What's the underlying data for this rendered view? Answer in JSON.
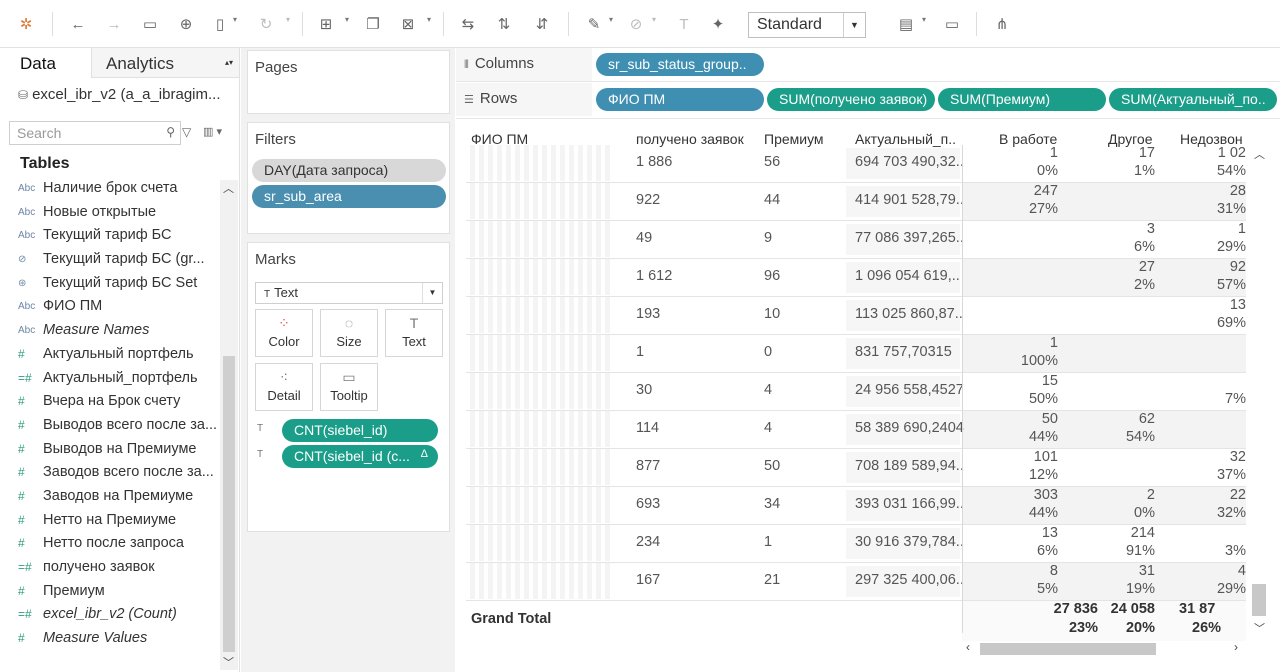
{
  "toolbar": {
    "view_mode": "Standard"
  },
  "data_pane": {
    "tab_data": "Data",
    "tab_analytics": "Analytics",
    "datasource": "excel_ibr_v2 (a_a_ibragim...",
    "search_placeholder": "Search",
    "tables_label": "Tables",
    "fields": [
      {
        "type": "Abc",
        "name": "Наличие брок счета",
        "kind": "dim"
      },
      {
        "type": "Abc",
        "name": "Новые открытые",
        "kind": "dim"
      },
      {
        "type": "Abc",
        "name": "Текущий тариф БС",
        "kind": "dim"
      },
      {
        "type": "⊘",
        "name": "Текущий тариф БС (gr...",
        "kind": "dim"
      },
      {
        "type": "⊛",
        "name": "Текущий тариф БС Set",
        "kind": "dim"
      },
      {
        "type": "Abc",
        "name": "ФИО ПМ",
        "kind": "dim"
      },
      {
        "type": "Abc",
        "name": "Measure Names",
        "kind": "dim",
        "italic": true
      },
      {
        "type": "#",
        "name": "Актуальный портфель",
        "kind": "measure"
      },
      {
        "type": "=#",
        "name": "Актуальный_портфель",
        "kind": "measure"
      },
      {
        "type": "#",
        "name": "Вчера на Брок счету",
        "kind": "measure"
      },
      {
        "type": "#",
        "name": "Выводов всего после за...",
        "kind": "measure"
      },
      {
        "type": "#",
        "name": "Выводов на Премиуме",
        "kind": "measure"
      },
      {
        "type": "#",
        "name": "Заводов всего после за...",
        "kind": "measure"
      },
      {
        "type": "#",
        "name": "Заводов на Премиуме",
        "kind": "measure"
      },
      {
        "type": "#",
        "name": "Нетто на Премиуме",
        "kind": "measure"
      },
      {
        "type": "#",
        "name": "Нетто после запроса",
        "kind": "measure"
      },
      {
        "type": "=#",
        "name": "получено заявок",
        "kind": "measure"
      },
      {
        "type": "#",
        "name": "Премиум",
        "kind": "measure"
      },
      {
        "type": "=#",
        "name": "excel_ibr_v2 (Count)",
        "kind": "measure",
        "italic": true
      },
      {
        "type": "#",
        "name": "Measure Values",
        "kind": "measure",
        "italic": true
      }
    ]
  },
  "cards": {
    "pages_title": "Pages",
    "filters_title": "Filters",
    "filters": [
      "DAY(Дата запроса)",
      "sr_sub_area"
    ],
    "marks_title": "Marks",
    "marks_type": "Text",
    "mark_buttons": [
      "Color",
      "Size",
      "Text",
      "Detail",
      "Tooltip"
    ],
    "mark_pills": [
      "CNT(siebel_id)",
      "CNT(siebel_id (c..."
    ]
  },
  "shelves": {
    "columns_label": "Columns",
    "rows_label": "Rows",
    "columns": [
      "sr_sub_status_group.."
    ],
    "rows": [
      "ФИО ПМ",
      "SUM(получено заявок)",
      "SUM(Премиум)",
      "SUM(Актуальный_по.."
    ]
  },
  "table": {
    "headers": [
      "ФИО ПМ",
      "получено заявок",
      "Премиум",
      "Актуальный_п..",
      "В работе",
      "Другое",
      "Недозвон"
    ],
    "rows": [
      {
        "received": "1 886",
        "premium": "56",
        "portfolio": "694 703 490,32..",
        "work": [
          "1",
          "0%"
        ],
        "other": [
          "17",
          "1%"
        ],
        "nocall": [
          "1 02",
          "54%"
        ]
      },
      {
        "received": "922",
        "premium": "44",
        "portfolio": "414 901 528,79..",
        "work": [
          "247",
          "27%"
        ],
        "other": [
          "",
          ""
        ],
        "nocall": [
          "28",
          "31%"
        ]
      },
      {
        "received": "49",
        "premium": "9",
        "portfolio": "77 086 397,265..",
        "work": [
          "",
          ""
        ],
        "other": [
          "3",
          "6%"
        ],
        "nocall": [
          "1",
          "29%"
        ]
      },
      {
        "received": "1 612",
        "premium": "96",
        "portfolio": "1 096 054 619,..",
        "work": [
          "",
          ""
        ],
        "other": [
          "27",
          "2%"
        ],
        "nocall": [
          "92",
          "57%"
        ]
      },
      {
        "received": "193",
        "premium": "10",
        "portfolio": "113 025 860,87..",
        "work": [
          "",
          ""
        ],
        "other": [
          "",
          ""
        ],
        "nocall": [
          "13",
          "69%"
        ]
      },
      {
        "received": "1",
        "premium": "0",
        "portfolio": "831 757,70315",
        "work": [
          "1",
          "100%"
        ],
        "other": [
          "",
          ""
        ],
        "nocall": [
          "",
          ""
        ]
      },
      {
        "received": "30",
        "premium": "4",
        "portfolio": "24 956 558,4527",
        "work": [
          "15",
          "50%"
        ],
        "other": [
          "",
          ""
        ],
        "nocall": [
          "",
          "7%"
        ]
      },
      {
        "received": "114",
        "premium": "4",
        "portfolio": "58 389 690,2404",
        "work": [
          "50",
          "44%"
        ],
        "other": [
          "62",
          "54%"
        ],
        "nocall": [
          "",
          ""
        ]
      },
      {
        "received": "877",
        "premium": "50",
        "portfolio": "708 189 589,94..",
        "work": [
          "101",
          "12%"
        ],
        "other": [
          "",
          ""
        ],
        "nocall": [
          "32",
          "37%"
        ]
      },
      {
        "received": "693",
        "premium": "34",
        "portfolio": "393 031 166,99..",
        "work": [
          "303",
          "44%"
        ],
        "other": [
          "2",
          "0%"
        ],
        "nocall": [
          "22",
          "32%"
        ]
      },
      {
        "received": "234",
        "premium": "1",
        "portfolio": "30 916 379,784..",
        "work": [
          "13",
          "6%"
        ],
        "other": [
          "214",
          "91%"
        ],
        "nocall": [
          "",
          "3%"
        ]
      },
      {
        "received": "167",
        "premium": "21",
        "portfolio": "297 325 400,06..",
        "work": [
          "8",
          "5%"
        ],
        "other": [
          "31",
          "19%"
        ],
        "nocall": [
          "4",
          "29%"
        ]
      }
    ],
    "grand_total_label": "Grand Total",
    "grand_total": {
      "work": [
        "27 836",
        "23%"
      ],
      "other": [
        "24 058",
        "20%"
      ],
      "nocall": [
        "31 87",
        "26%"
      ]
    }
  }
}
